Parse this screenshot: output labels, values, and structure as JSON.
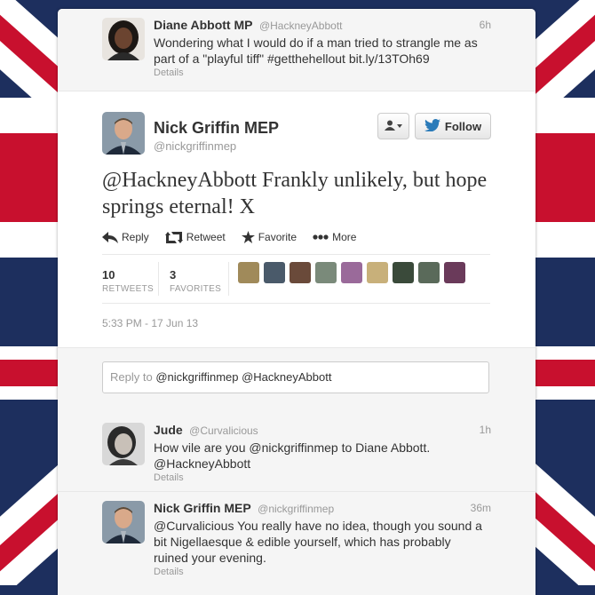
{
  "colors": {
    "accent": "#2b7bb9",
    "flag_blue": "#1d2f5e",
    "flag_red": "#c8102e",
    "card_bg": "#ffffff",
    "secondary_text": "#999999"
  },
  "tweet_prev": {
    "name": "Diane Abbott MP",
    "handle": "@HackneyAbbott",
    "time": "6h",
    "text_line1": "Wondering what I would do if a man tried to strangle me as",
    "text_line2_pre": "part of a \"playful tiff\" ",
    "hashtag": "#getthehellout",
    "link": "bit.ly/13TOh69",
    "details": "Details"
  },
  "focus": {
    "name": "Nick Griffin MEP",
    "handle": "@nickgriffinmep",
    "follow_label": "Follow",
    "text": "@HackneyAbbott Frankly unlikely, but hope springs eternal! X",
    "actions": {
      "reply": "Reply",
      "retweet": "Retweet",
      "favorite": "Favorite",
      "more": "More"
    },
    "retweets": {
      "count": "10",
      "label": "RETWEETS"
    },
    "favorites": {
      "count": "3",
      "label": "FAVORITES"
    },
    "date": "5:33 PM - 17 Jun 13",
    "icons": [
      "user-menu-icon",
      "twitter-bird-icon",
      "reply-icon",
      "retweet-icon",
      "star-icon",
      "ellipsis-icon"
    ]
  },
  "reply": {
    "placeholder": "Reply to",
    "mentions": "@nickgriffinmep @HackneyAbbott"
  },
  "replies": [
    {
      "name": "Jude",
      "handle": "@Curvalicious",
      "time": "1h",
      "line1": "How vile are you @nickgriffinmep to Diane Abbott.",
      "line2": "@HackneyAbbott",
      "details": "Details"
    },
    {
      "name": "Nick Griffin MEP",
      "handle": "@nickgriffinmep",
      "time": "36m",
      "line1": "@Curvalicious You really have no idea, though you sound a",
      "line2": "bit Nigellaesque & edible yourself, which has probably",
      "line3": "ruined your evening.",
      "details": "Details"
    }
  ]
}
